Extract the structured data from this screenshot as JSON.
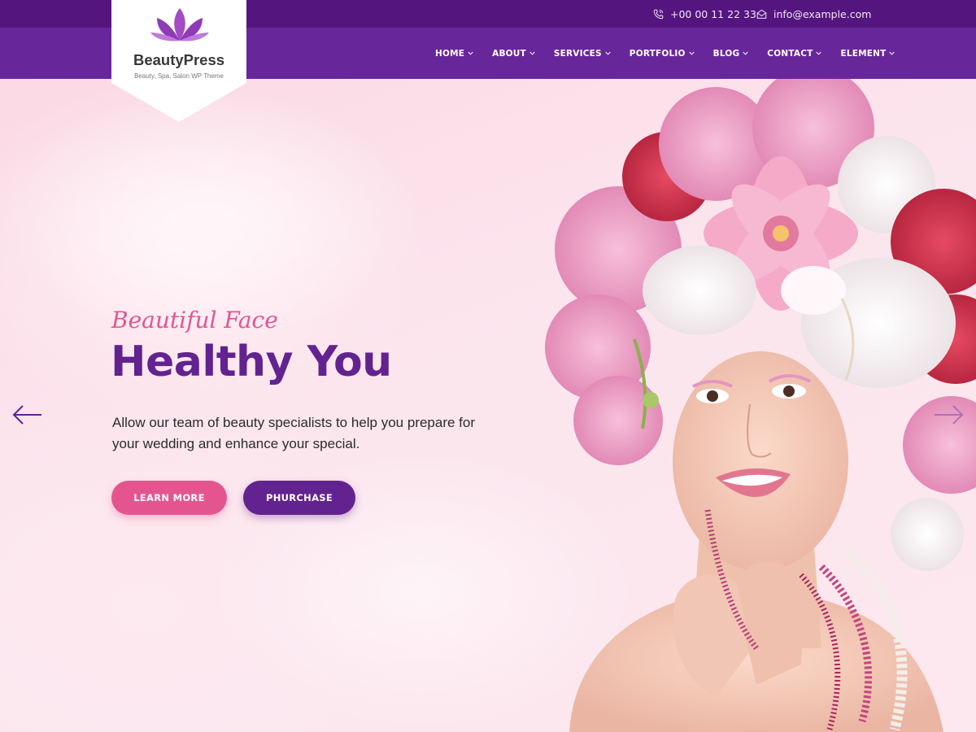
{
  "topbar": {
    "phone": "+00 00 11 22 33",
    "email": "info@example.com",
    "phone_icon": "phone-icon",
    "email_icon": "envelope-icon"
  },
  "logo": {
    "name": "BeautyPress",
    "tagline": "Beauty, Spa, Salon WP Theme",
    "icon": "lotus-icon"
  },
  "nav": {
    "items": [
      {
        "label": "HOME"
      },
      {
        "label": "ABOUT"
      },
      {
        "label": "SERVICES"
      },
      {
        "label": "PORTFOLIO"
      },
      {
        "label": "BLOG"
      },
      {
        "label": "CONTACT"
      },
      {
        "label": "ELEMENT"
      }
    ],
    "dropdown_icon": "chevron-down-icon"
  },
  "hero": {
    "subtitle": "Beautiful Face",
    "headline": "Healthy You",
    "description": "Allow our team of beauty specialists to help you prepare for your wedding and enhance your special.",
    "learn_more_label": "LEARN MORE",
    "purchase_label": "PHURCHASE",
    "prev_icon": "arrow-left-icon",
    "next_icon": "arrow-right-icon"
  },
  "colors": {
    "topbar": "#55157f",
    "navbar": "#67279b",
    "accent_pink": "#e4558f",
    "accent_purple": "#62228f",
    "subtitle_pink": "#e05593"
  }
}
